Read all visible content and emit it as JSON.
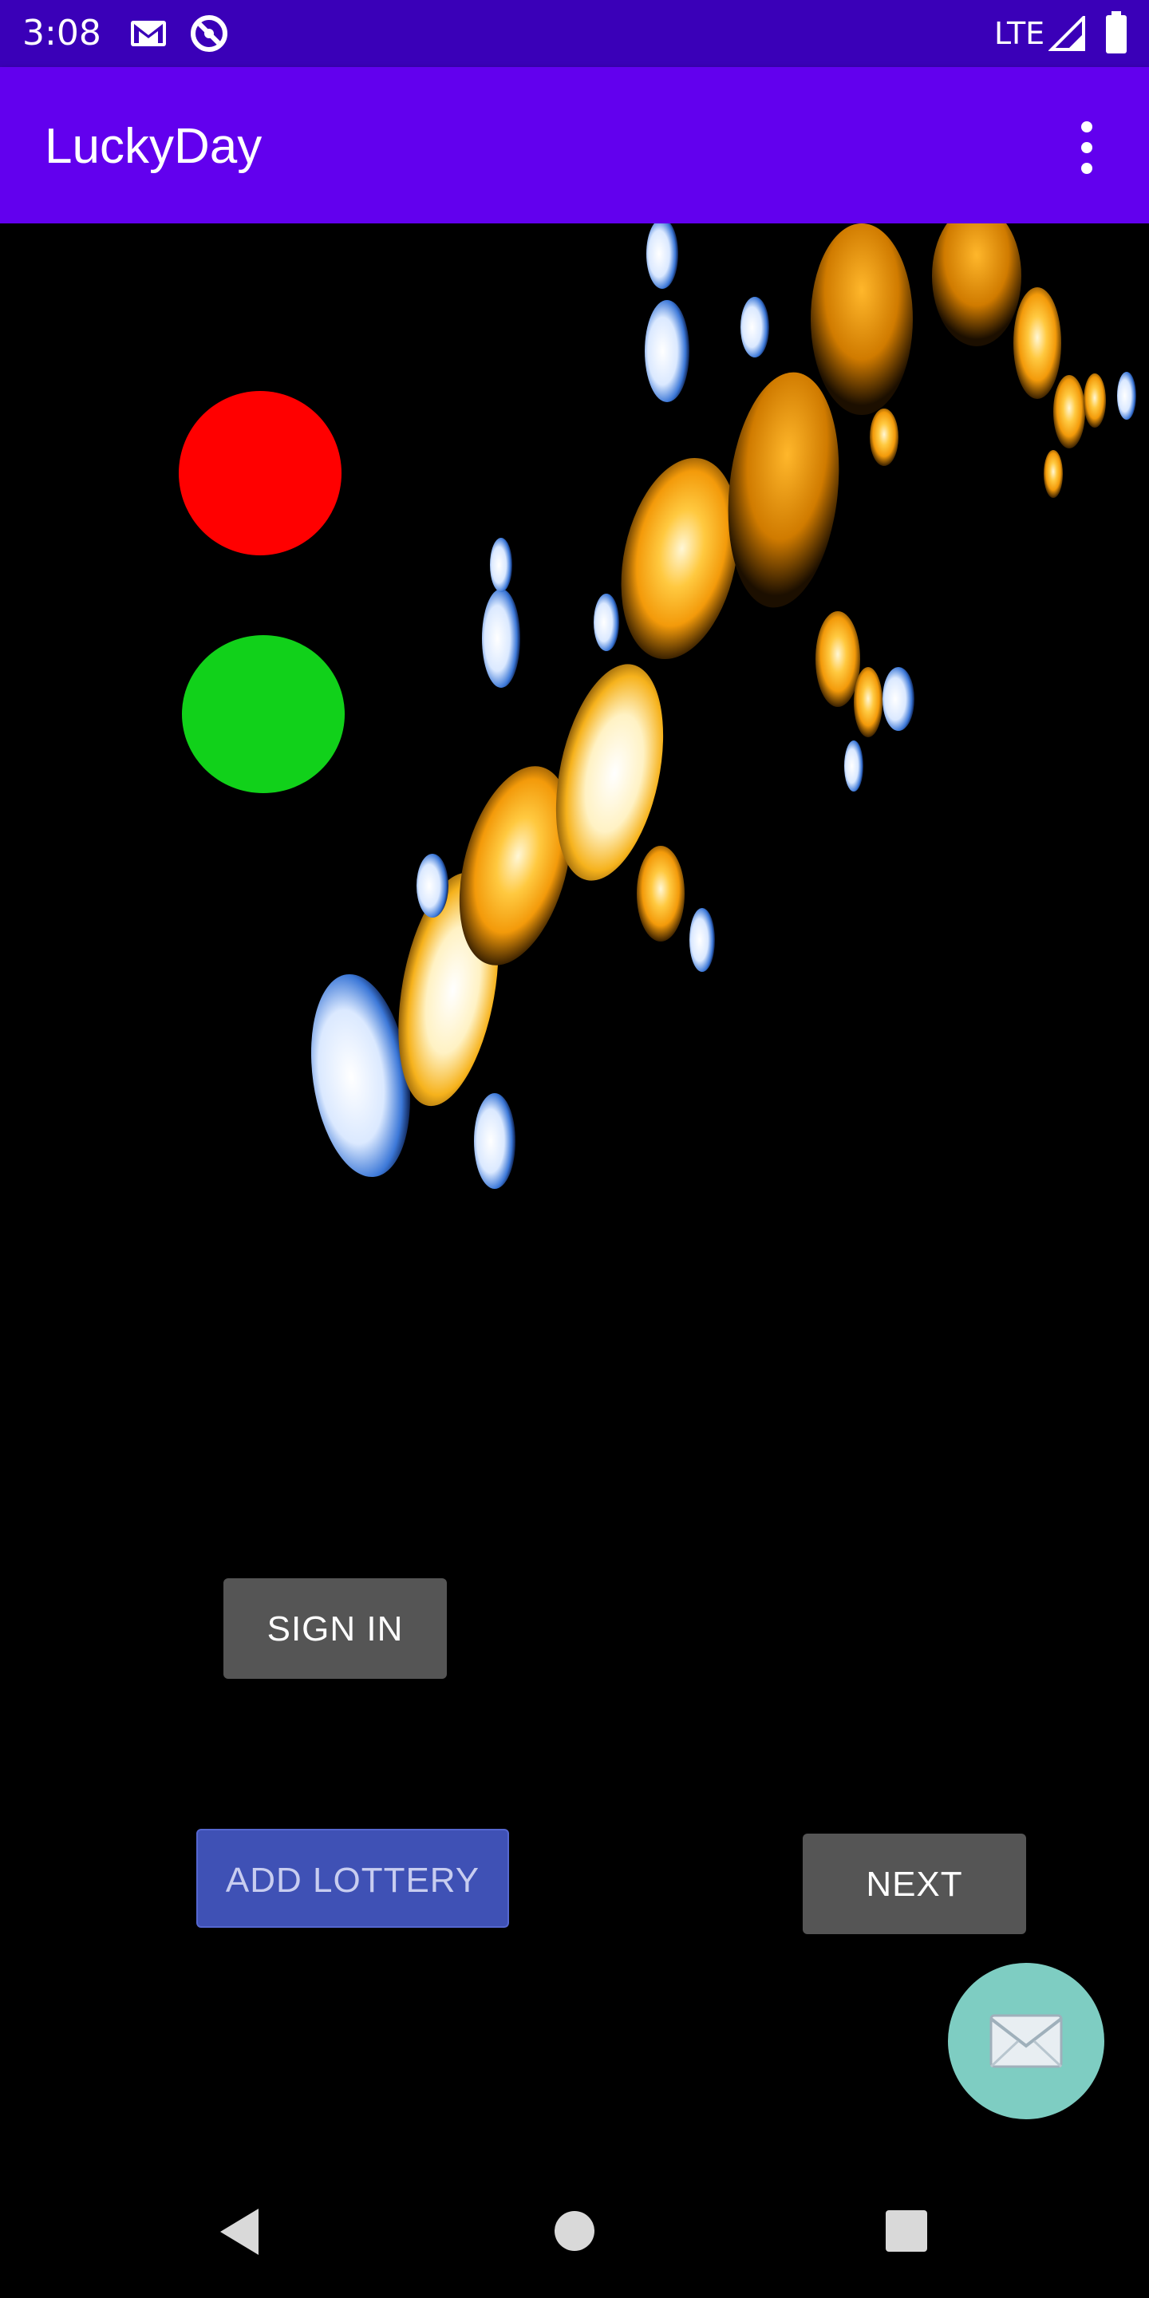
{
  "status_bar": {
    "time": "3:08",
    "network": "LTE",
    "icons": [
      "gmail-icon",
      "sync-icon",
      "signal-icon",
      "battery-icon"
    ]
  },
  "app_bar": {
    "title": "LuckyDay",
    "overflow_icon": "more-vert-icon"
  },
  "main": {
    "indicators": [
      {
        "name": "red-indicator",
        "color": "#ff0000"
      },
      {
        "name": "green-indicator",
        "color": "#11d11a"
      }
    ],
    "buttons": {
      "sign_in": "SIGN IN",
      "add_lottery": "ADD LOTTERY",
      "next": "NEXT"
    },
    "fab_icon": "email-icon",
    "image": "fractal-image"
  },
  "nav_bar": {
    "icons": [
      "back-icon",
      "home-icon",
      "recents-icon"
    ]
  },
  "colors": {
    "status_bar": "#3a00b8",
    "app_bar": "#6200ee",
    "button_gray": "#555555",
    "button_blue": "#3f51b5",
    "fab": "#7ecdc2"
  }
}
